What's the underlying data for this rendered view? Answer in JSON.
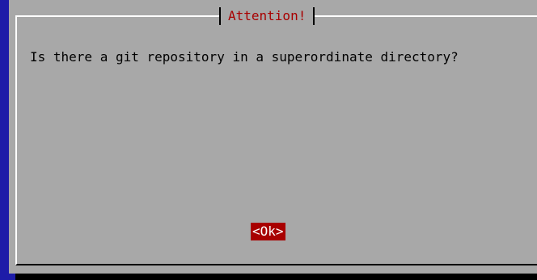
{
  "dialog": {
    "title": "Attention!",
    "message": "Is there a git repository in a superordinate directory?",
    "ok_label": "<Ok>"
  },
  "colors": {
    "background": "#1d1ca8",
    "dialog": "#a8a8a8",
    "title_text": "#a80000",
    "button_bg": "#a80000",
    "button_text": "#ffffff"
  }
}
